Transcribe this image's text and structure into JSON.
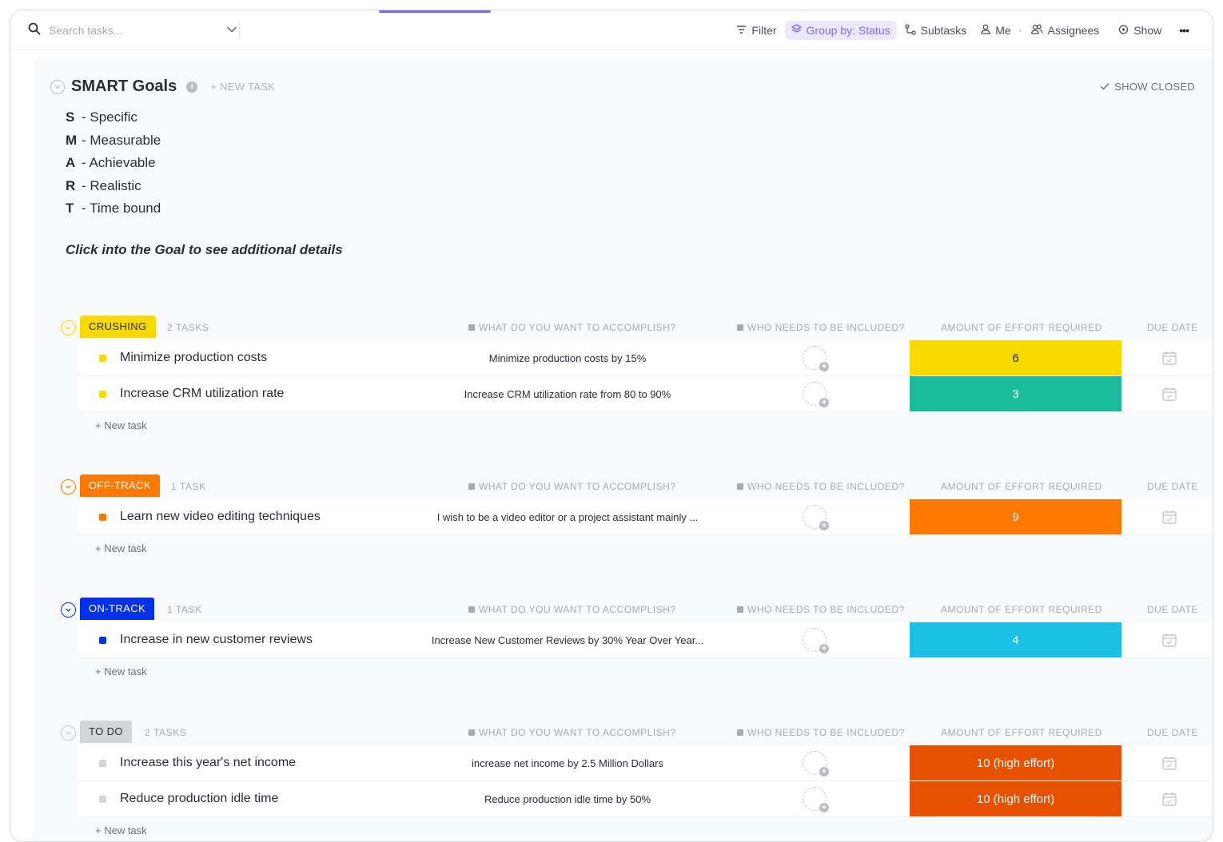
{
  "toolbar": {
    "search_placeholder": "Search tasks...",
    "filter": "Filter",
    "group_by": "Group by: Status",
    "subtasks": "Subtasks",
    "me": "Me",
    "assignees": "Assignees",
    "show": "Show",
    "more": "•••"
  },
  "list": {
    "title": "SMART Goals",
    "info_glyph": "i",
    "new_task": "+ NEW TASK",
    "show_closed": "SHOW CLOSED",
    "smart": [
      {
        "letter": "S",
        "text": "- Specific"
      },
      {
        "letter": "M",
        "text": "- Measurable"
      },
      {
        "letter": "A",
        "text": "- Achievable"
      },
      {
        "letter": "R",
        "text": "- Realistic"
      },
      {
        "letter": "T",
        "text": "- Time bound"
      }
    ],
    "hint": "Click into the Goal to see additional details"
  },
  "columns": {
    "accomplish": "WHAT DO YOU WANT TO ACCOMPLISH?",
    "included": "WHO NEEDS TO BE INCLUDED?",
    "effort": "AMOUNT OF EFFORT REQUIRED",
    "due": "DUE DATE"
  },
  "new_task_label": "+ New task",
  "groups": [
    {
      "status": "CRUSHING",
      "count": "2 TASKS",
      "badge_bg": "#f9d900",
      "badge_fg": "#292d34",
      "toggle_color": "#f9d900",
      "tasks": [
        {
          "name": "Minimize production costs",
          "accomplish": "Minimize production costs by 15%",
          "effort": "6",
          "effort_color": "#f9d900",
          "effort_fg": "#292d34"
        },
        {
          "name": "Increase CRM utilization rate",
          "accomplish": "Increase CRM utilization rate from 80 to 90%",
          "effort": "3",
          "effort_color": "#1bbc9c",
          "effort_fg": "#ffffff"
        }
      ]
    },
    {
      "status": "OFF-TRACK",
      "count": "1 TASK",
      "badge_bg": "#ff7800",
      "badge_fg": "#ffffff",
      "toggle_color": "#ff7800",
      "tasks": [
        {
          "name": "Learn new video editing techniques",
          "accomplish": "I wish to be a video editor or a project assistant mainly ...",
          "effort": "9",
          "effort_color": "#ff7800",
          "effort_fg": "#ffffff"
        }
      ]
    },
    {
      "status": "ON-TRACK",
      "count": "1 TASK",
      "badge_bg": "#0231e8",
      "badge_fg": "#ffffff",
      "toggle_color": "#0231e8",
      "tasks": [
        {
          "name": "Increase in new customer reviews",
          "accomplish": "Increase New Customer Reviews by 30% Year Over Year...",
          "effort": "4",
          "effort_color": "#1ac1e3",
          "effort_fg": "#ffffff"
        }
      ]
    },
    {
      "status": "TO DO",
      "count": "2 TASKS",
      "badge_bg": "#d3d5d9",
      "badge_fg": "#292d34",
      "toggle_color": "#c4c7cc",
      "tasks": [
        {
          "name": "Increase this year's net income",
          "accomplish": "increase net income by 2.5 Million Dollars",
          "effort": "10 (high effort)",
          "effort_color": "#e65100",
          "effort_fg": "#ffffff"
        },
        {
          "name": "Reduce production idle time",
          "accomplish": "Reduce production idle time by 50%",
          "effort": "10 (high effort)",
          "effort_color": "#e65100",
          "effort_fg": "#ffffff"
        }
      ]
    }
  ]
}
